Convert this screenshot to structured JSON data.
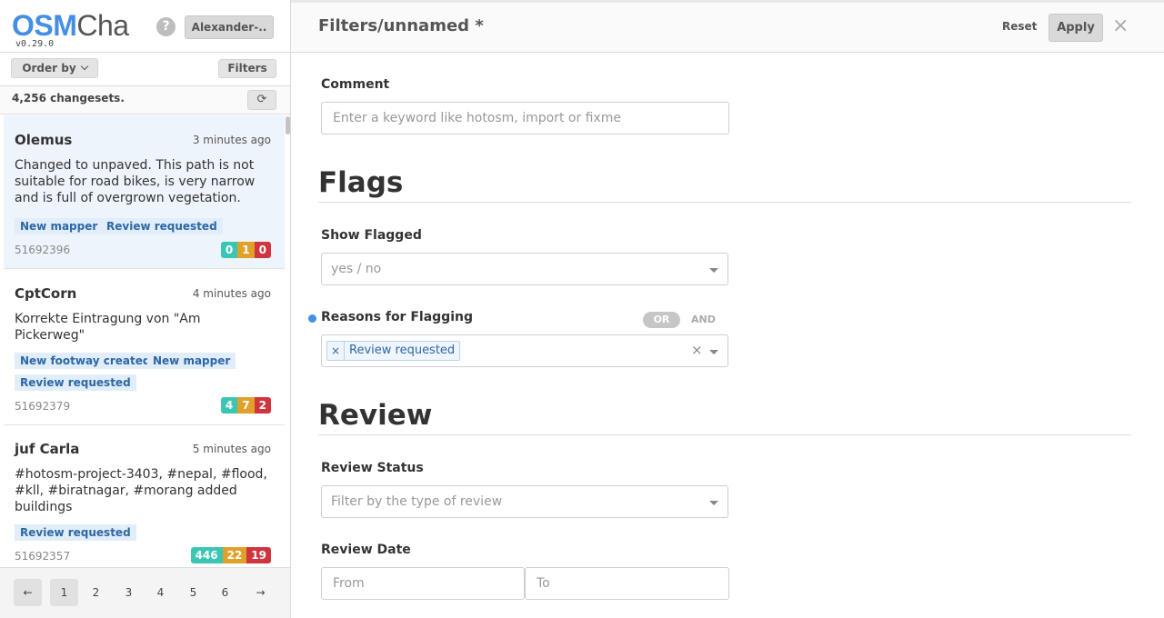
{
  "sidebar": {
    "logo_osm": "OSM",
    "logo_cha": "Cha",
    "version": "v0.29.0",
    "help_label": "?",
    "user_label": "Alexander-..",
    "order_by_label": "Order by",
    "filters_label": "Filters",
    "count_text": "4,256 changesets.",
    "refresh_icon": "⟳",
    "changesets": [
      {
        "user": "Olemus",
        "time": "3 minutes ago",
        "comment": "Changed to unpaved. This path is not suitable for road bikes, is very narrow and is full of overgrown vegetation.",
        "tags": [
          "New mapper",
          "Review requested"
        ],
        "id": "51692396",
        "create": "0",
        "modify": "1",
        "delete": "0"
      },
      {
        "user": "CptCorn",
        "time": "4 minutes ago",
        "comment": "Korrekte Eintragung von \"Am Pickerweg\"",
        "tags": [
          "New footway created",
          "New mapper",
          "Review requested"
        ],
        "id": "51692379",
        "create": "4",
        "modify": "7",
        "delete": "2"
      },
      {
        "user": "juf Carla",
        "time": "5 minutes ago",
        "comment": "#hotosm-project-3403, #nepal, #flood, #kll, #biratnagar, #morang added buildings",
        "tags": [
          "Review requested"
        ],
        "id": "51692357",
        "create": "446",
        "modify": "22",
        "delete": "19"
      }
    ],
    "pagination": {
      "prev": "←",
      "pages": [
        "1",
        "2",
        "3",
        "4",
        "5",
        "6"
      ],
      "next": "→"
    }
  },
  "header": {
    "title": "Filters/unnamed *",
    "reset_label": "Reset",
    "apply_label": "Apply",
    "close_label": "×"
  },
  "filters": {
    "comment_label": "Comment",
    "comment_placeholder": "Enter a keyword like hotosm, import or fixme",
    "flags_title": "Flags",
    "show_flagged_label": "Show Flagged",
    "show_flagged_value": "yes / no",
    "reasons_label": "Reasons for Flagging",
    "or_label": "OR",
    "and_label": "AND",
    "reason_chip_remove": "×",
    "reason_chip": "Review requested",
    "clear_label": "×",
    "review_title": "Review",
    "review_status_label": "Review Status",
    "review_status_placeholder": "Filter by the type of review",
    "review_date_label": "Review Date",
    "from_placeholder": "From",
    "to_placeholder": "To"
  },
  "colors": {
    "accent": "#448ee4",
    "create": "#3bc6b4",
    "modify": "#e0a12a",
    "delete": "#d0343e"
  }
}
